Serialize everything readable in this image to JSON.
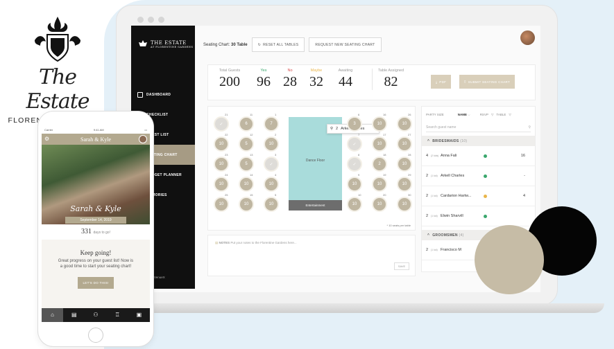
{
  "logo": {
    "script": "The Estate",
    "at": "AT",
    "sub": "FLORENTINE GARDENS"
  },
  "app": {
    "brand": "THE ESTATE",
    "brand_sub": "AT FLORENTINE GARDENS",
    "nav": [
      {
        "label": "DASHBOARD"
      },
      {
        "label": "CHECKLIST"
      },
      {
        "label": "GUEST LIST"
      },
      {
        "label": "SEATING CHART"
      },
      {
        "label": "BUDGET PLANNER"
      },
      {
        "label": "MEMORIES"
      }
    ],
    "powered": "Powered by VenueX"
  },
  "topbar": {
    "label_prefix": "Seating Chart:",
    "label_value": "30 Table",
    "reset": "RESET ALL TABLES",
    "request": "REQUEST NEW SEATING CHART"
  },
  "stats": {
    "total_label": "Total Guests",
    "total": "200",
    "yes_label": "Yes",
    "yes": "96",
    "no_label": "No",
    "no": "28",
    "maybe_label": "Maybe",
    "maybe": "32",
    "await_label": "Awaiting",
    "await": "44",
    "assigned_label": "Table Assigned",
    "assigned": "82",
    "pdf": "PDF",
    "submit": "SUBMIT SEATING CHART"
  },
  "colors": {
    "yes": "#3aa76d",
    "no": "#d84b4b",
    "maybe": "#e9b54a",
    "gold": "#bfb6a1"
  },
  "chart": {
    "dance_floor": "Dance Floor",
    "entertainment": "Entertainment",
    "tooltip": "Arkell Charles",
    "tooltip_prefix": "2",
    "seats_note": "* 10 seats per table",
    "tables": [
      {
        "num": "21",
        "val": "✓"
      },
      {
        "num": "11",
        "val": "6"
      },
      {
        "num": "1",
        "val": "7"
      },
      {
        "num": "22",
        "val": "10"
      },
      {
        "num": "12",
        "val": "5"
      },
      {
        "num": "2",
        "val": "10"
      },
      {
        "num": "23",
        "val": "10"
      },
      {
        "num": "13",
        "val": "5"
      },
      {
        "num": "3",
        "val": "✓"
      },
      {
        "num": "24",
        "val": "10"
      },
      {
        "num": "14",
        "val": "10"
      },
      {
        "num": "4",
        "val": "10"
      },
      {
        "num": "25",
        "val": "10"
      },
      {
        "num": "15",
        "val": "10"
      },
      {
        "num": "5",
        "val": "10"
      },
      {
        "num": "6",
        "val": "3"
      },
      {
        "num": "16",
        "val": "10"
      },
      {
        "num": "26",
        "val": "10"
      },
      {
        "num": "7",
        "val": "✓"
      },
      {
        "num": "17",
        "val": "10"
      },
      {
        "num": "27",
        "val": "10"
      },
      {
        "num": "8",
        "val": "✓"
      },
      {
        "num": "18",
        "val": "2"
      },
      {
        "num": "28",
        "val": "10"
      },
      {
        "num": "9",
        "val": "10"
      },
      {
        "num": "19",
        "val": "10"
      },
      {
        "num": "29",
        "val": "10"
      },
      {
        "num": "10",
        "val": "10"
      },
      {
        "num": "20",
        "val": "10"
      },
      {
        "num": "30",
        "val": "10"
      }
    ]
  },
  "notes": {
    "label": "NOTES",
    "placeholder": "Put your notes to the Florentine Gardens here...",
    "save": "SAVE"
  },
  "guests": {
    "col_party": "PARTY SIZE",
    "col_name": "NAME",
    "col_rsvp": "RSVP",
    "col_table": "TABLE",
    "search_placeholder": "Search guest name",
    "group1": "BRIDESMAIDS",
    "group1_count": "(10)",
    "rows": [
      {
        "n": "4",
        "k": "(2 kids)",
        "name": "Anna Fali",
        "rsvp": "#3aa76d",
        "table": "16"
      },
      {
        "n": "2",
        "k": "(1 kid)",
        "name": "Arkell Charles",
        "rsvp": "#3aa76d",
        "table": "-"
      },
      {
        "n": "2",
        "k": "(1 kid)",
        "name": "Cardarion Hartw...",
        "rsvp": "#e9b54a",
        "table": "4"
      },
      {
        "n": "2",
        "k": "(1 kid)",
        "name": "Elwin Sharvill",
        "rsvp": "#3aa76d",
        "table": ""
      }
    ],
    "group2": "GROOMSMEN",
    "group2_count": "(4)",
    "row5": {
      "n": "2",
      "k": "(1 kid)",
      "name": "Francisco M"
    }
  },
  "phone": {
    "carrier": "Carrier",
    "time": "9:41 AM",
    "title": "Sarah & Kyle",
    "couple": "Sarah & Kyle",
    "date": "September 14, 2019",
    "days": "331",
    "days_label": "days to go!",
    "card_title": "Keep going!",
    "card_text": "Great progress on your guest list! Now is a good time to start your seating chart!",
    "cta": "LET'S DO THIS!"
  }
}
